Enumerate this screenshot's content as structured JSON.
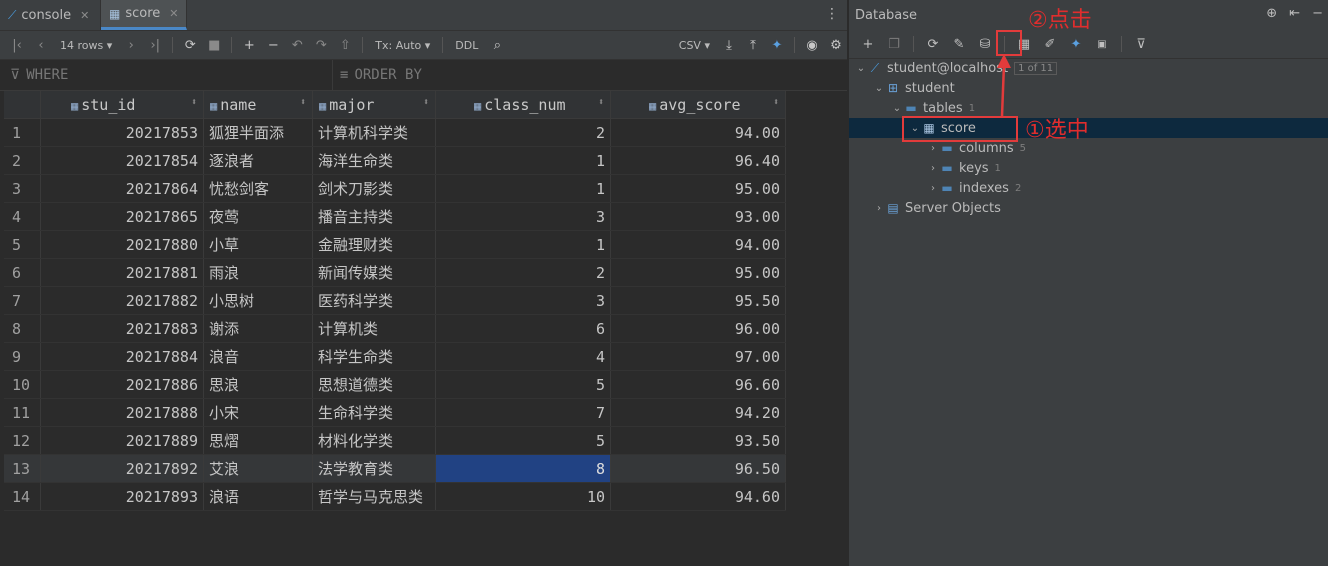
{
  "editor": {
    "tabs": [
      {
        "label": "console",
        "icon": "console-icon"
      },
      {
        "label": "score",
        "icon": "table-icon"
      }
    ],
    "toolbar": {
      "rows_label": "14 rows",
      "tx_label": "Tx: Auto",
      "ddl_label": "DDL",
      "export_label": "CSV"
    },
    "filter": {
      "where_label": "WHERE",
      "order_label": "ORDER BY"
    },
    "grid": {
      "columns": [
        "stu_id",
        "name",
        "major",
        "class_num",
        "avg_score"
      ],
      "rows": [
        [
          "1",
          "20217853",
          "狐狸半面添",
          "计算机科学类",
          "2",
          "94.00"
        ],
        [
          "2",
          "20217854",
          "逐浪者",
          "海洋生命类",
          "1",
          "96.40"
        ],
        [
          "3",
          "20217864",
          "忧愁剑客",
          "剑术刀影类",
          "1",
          "95.00"
        ],
        [
          "4",
          "20217865",
          "夜莺",
          "播音主持类",
          "3",
          "93.00"
        ],
        [
          "5",
          "20217880",
          "小草",
          "金融理财类",
          "1",
          "94.00"
        ],
        [
          "6",
          "20217881",
          "雨浪",
          "新闻传媒类",
          "2",
          "95.00"
        ],
        [
          "7",
          "20217882",
          "小思树",
          "医药科学类",
          "3",
          "95.50"
        ],
        [
          "8",
          "20217883",
          "谢添",
          "计算机类",
          "6",
          "96.00"
        ],
        [
          "9",
          "20217884",
          "浪音",
          "科学生命类",
          "4",
          "97.00"
        ],
        [
          "10",
          "20217886",
          "思浪",
          "思想道德类",
          "5",
          "96.60"
        ],
        [
          "11",
          "20217888",
          "小宋",
          "生命科学类",
          "7",
          "94.20"
        ],
        [
          "12",
          "20217889",
          "思熠",
          "材料化学类",
          "5",
          "93.50"
        ],
        [
          "13",
          "20217892",
          "艾浪",
          "法学教育类",
          "8",
          "96.50"
        ],
        [
          "14",
          "20217893",
          "浪语",
          "哲学与马克思类",
          "10",
          "94.60"
        ]
      ]
    }
  },
  "database": {
    "title": "Database",
    "tree": {
      "connection": {
        "label": "student@localhost",
        "badge": "1 of 11"
      },
      "schema": {
        "label": "student"
      },
      "tables": {
        "label": "tables",
        "count": "1"
      },
      "table": {
        "label": "score"
      },
      "columns": {
        "label": "columns",
        "count": "5"
      },
      "keys": {
        "label": "keys",
        "count": "1"
      },
      "indexes": {
        "label": "indexes",
        "count": "2"
      },
      "server_objects": {
        "label": "Server Objects"
      }
    }
  },
  "annotations": {
    "click_label": "②点击",
    "select_label": "①选中",
    "color": "#e23b3b"
  }
}
